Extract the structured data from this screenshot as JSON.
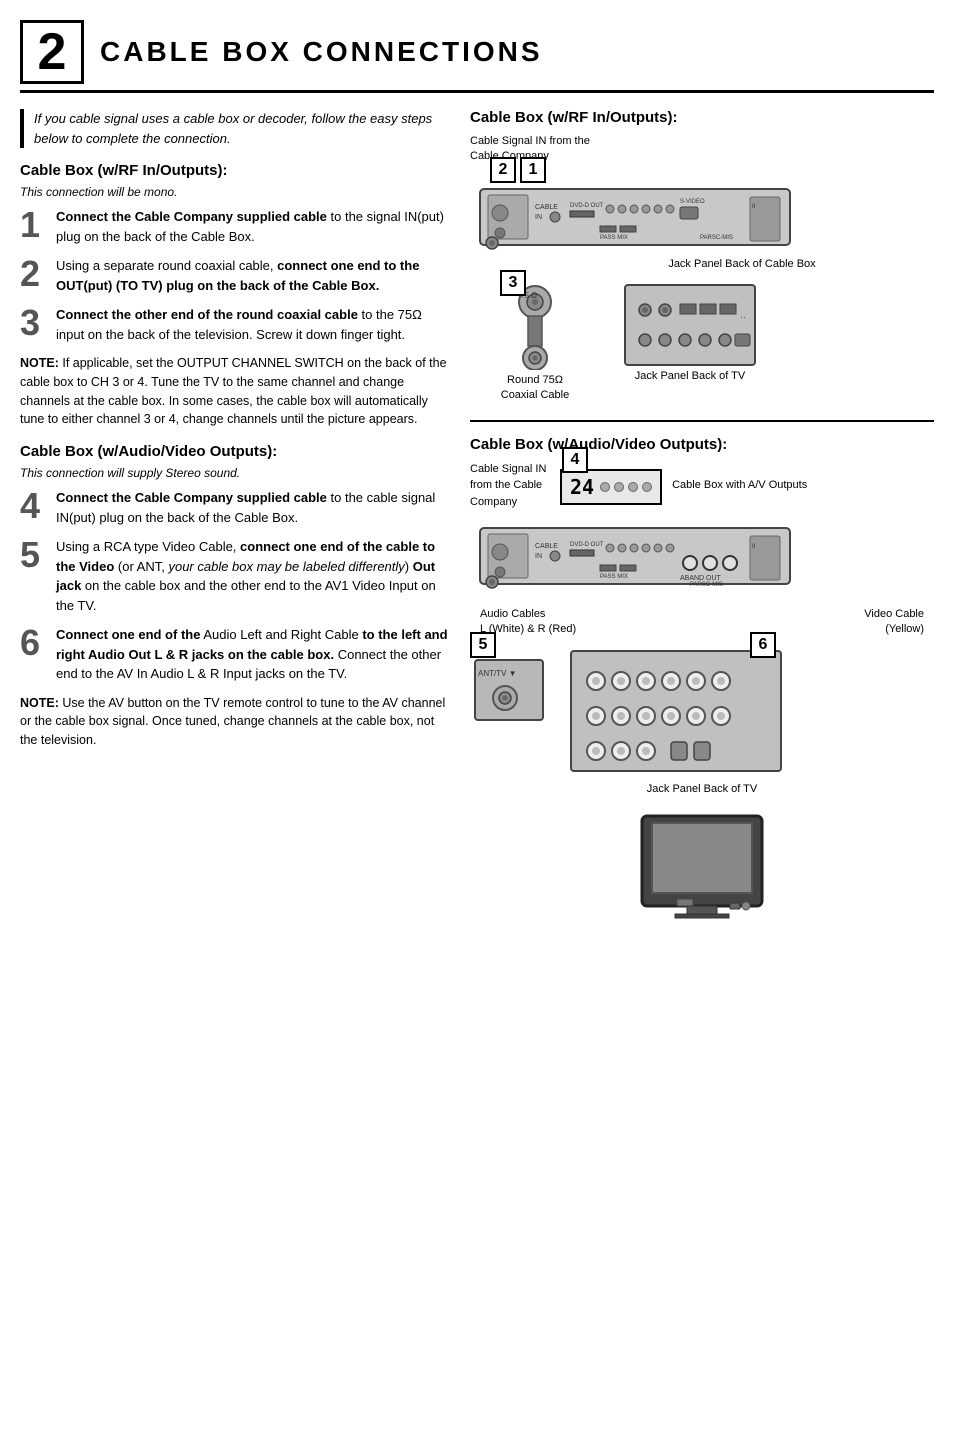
{
  "header": {
    "number": "2",
    "title": "Cable Box Connections"
  },
  "intro": {
    "text": "If you cable signal uses a cable box or decoder, follow the easy steps below to complete the connection."
  },
  "left": {
    "section1_title": "Cable Box (w/RF In/Outputs):",
    "section1_note": "This connection will be mono.",
    "steps": [
      {
        "num": "1",
        "text_bold": "Connect the Cable Company supplied cable",
        "text": " to the signal IN(put) plug on the back of the Cable Box."
      },
      {
        "num": "2",
        "text_bold": "connect one end to the OUT(put) (TO TV) plug on the back of the Cable Box.",
        "text_pre": "Using a separate round coaxial cable, ",
        "text": ""
      },
      {
        "num": "3",
        "text_bold": "Connect the other end of the round coaxial cable",
        "text": " to the 75Ω input on the back of the television. Screw it down finger tight."
      }
    ],
    "note1": "NOTE: If applicable, set the OUTPUT CHANNEL SWITCH on the back of the cable box to CH 3 or 4. Tune the TV to the same channel and change channels at the cable box. In some cases, the cable box will automatically tune to either channel 3 or 4, change channels until the picture appears.",
    "section2_title": "Cable Box (w/Audio/Video Outputs):",
    "section2_note": "This connection will supply Stereo sound.",
    "steps2": [
      {
        "num": "4",
        "text_bold": "Connect the Cable Company supplied cable",
        "text": " to the cable signal IN(put) plug on the back of the Cable Box."
      },
      {
        "num": "5",
        "text_pre": "Using a RCA type Video Cable, ",
        "text_bold": "connect one end of the cable to the Video",
        "text": " (or ANT, your cable box may be labeled differently) Out jack on the cable box and the other end to the AV1 Video Input on the TV."
      },
      {
        "num": "6",
        "text_bold": "Connect one end of the",
        "text_mid": " Audio Left and Right Cable ",
        "text_bold2": "to the left and right Audio Out L & R jacks on the cable box.",
        "text": " Connect the other end to the AV In Audio L & R Input jacks on the TV."
      }
    ],
    "note2": "NOTE: Use the AV button on the TV remote control to tune to the AV channel or the cable box signal. Once tuned, change channels at the cable box, not the television."
  },
  "right": {
    "section1_title": "Cable Box (w/RF In/Outputs):",
    "signal_label": "Cable Signal IN from the\nCable Company",
    "jack_panel_label": "Jack Panel Back of Cable Box",
    "coax_label": "Round 75Ω\nCoaxial Cable",
    "jack_tv_label": "Jack Panel Back of TV",
    "section2_title": "Cable Box (w/Audio/Video Outputs):",
    "signal_label2_line1": "Cable Signal IN",
    "signal_label2_line2": "from the Cable",
    "signal_label2_line3": "Company",
    "cb_av_label": "Cable Box with A/V Outputs",
    "audio_cables_label": "Audio Cables\nL (White) & R (Red)",
    "video_cable_label": "Video Cable\n(Yellow)",
    "jack_tv_label2": "Jack Panel Back of TV",
    "step_badges_top": [
      "2",
      "1"
    ],
    "step_badge_3": "3",
    "step_badge_4": "4",
    "step_badge_5": "5",
    "step_badge_6": "6",
    "ohm_label": "75 Ω"
  }
}
